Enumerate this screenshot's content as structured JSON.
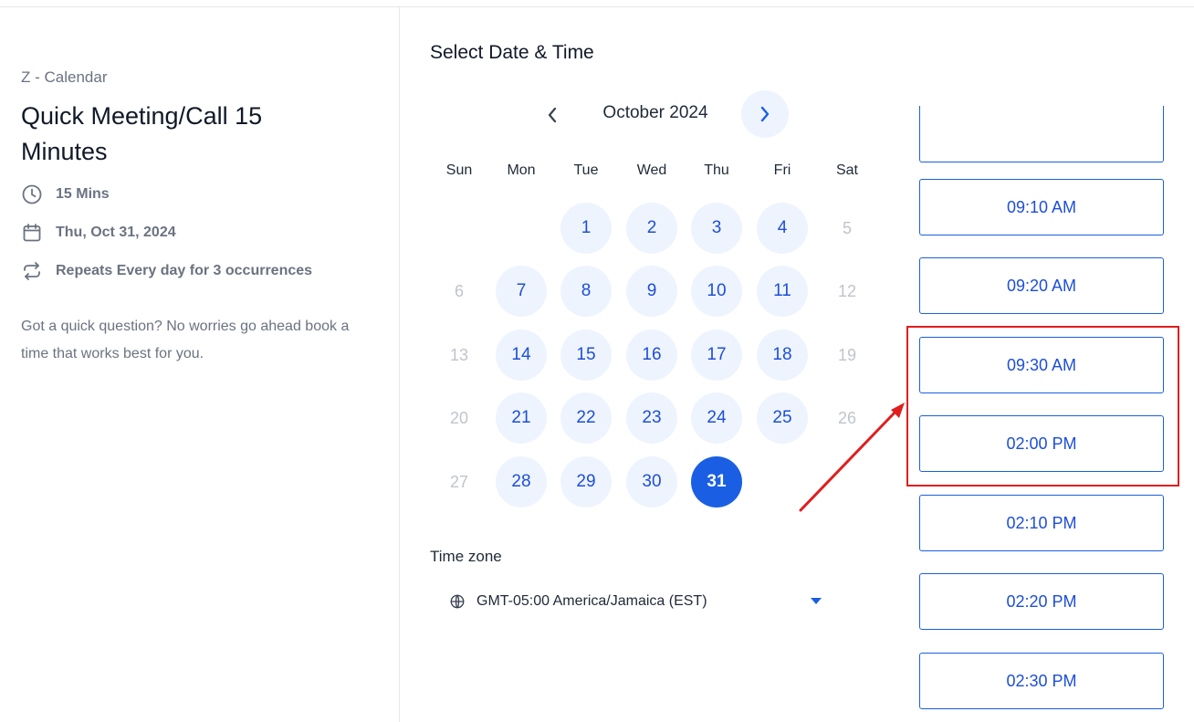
{
  "organizer": {
    "brand": "Z - Calendar",
    "title": "Quick Meeting/Call 15 Minutes",
    "duration": "15 Mins",
    "date": "Thu, Oct 31, 2024",
    "recurrence": "Repeats Every day for 3 occurrences",
    "description": "Got a quick question? No worries go ahead book a time that works best for you."
  },
  "picker": {
    "section_title": "Select Date & Time",
    "month_label": "October 2024",
    "weekdays": [
      "Sun",
      "Mon",
      "Tue",
      "Wed",
      "Thu",
      "Fri",
      "Sat"
    ],
    "weeks": [
      [
        null,
        null,
        "1",
        "2",
        "3",
        "4",
        "5"
      ],
      [
        "6",
        "7",
        "8",
        "9",
        "10",
        "11",
        "12"
      ],
      [
        "13",
        "14",
        "15",
        "16",
        "17",
        "18",
        "19"
      ],
      [
        "20",
        "21",
        "22",
        "23",
        "24",
        "25",
        "26"
      ],
      [
        "27",
        "28",
        "29",
        "30",
        "31",
        null,
        null
      ]
    ],
    "unavailable_days": [
      "5",
      "6",
      "12",
      "13",
      "19",
      "20",
      "26",
      "27"
    ],
    "selected_day": "31"
  },
  "timezone": {
    "label": "Time zone",
    "value": "GMT-05:00 America/Jamaica (EST)"
  },
  "time_slots": [
    "09:10 AM",
    "09:20 AM",
    "09:30 AM",
    "02:00 PM",
    "02:10 PM",
    "02:20 PM",
    "02:30 PM"
  ],
  "annotation": {
    "highlighted_slots": [
      "09:30 AM",
      "02:00 PM"
    ],
    "color": "#e01e1e"
  },
  "colors": {
    "accent": "#1a5fe3",
    "available_day_bg": "#eef4fe",
    "muted_text": "#6b7280"
  }
}
